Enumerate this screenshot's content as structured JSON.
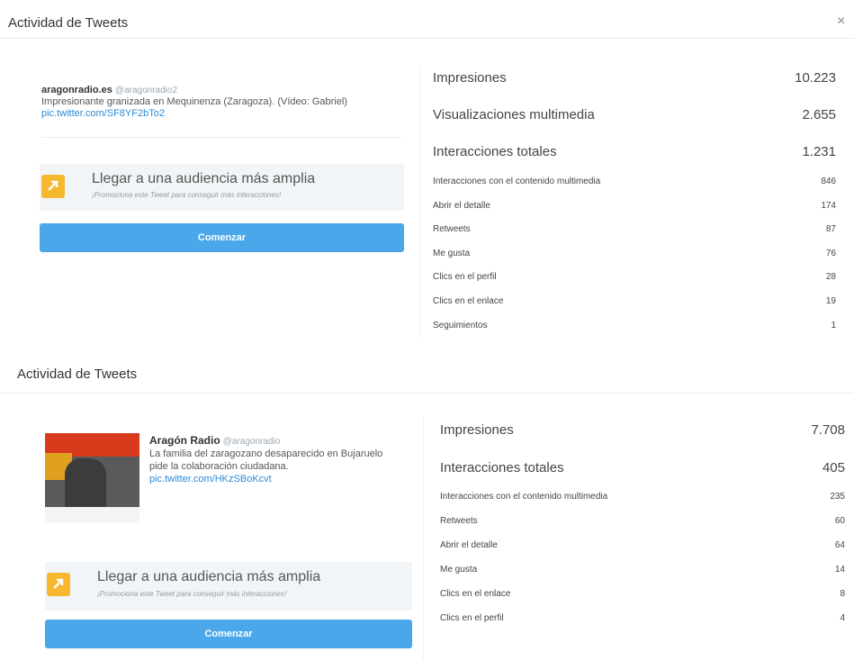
{
  "panel1": {
    "title": "Actividad de Tweets",
    "close": "×",
    "tweet": {
      "name": "aragonradio.es",
      "handle": "@aragonradio2",
      "text": "Impresionante granizada en Mequinenza (Zaragoza). (Vídeo: Gabriel)",
      "link": "pic.twitter.com/SF8YF2bTo2"
    },
    "promo": {
      "title": "Llegar a una audiencia más amplia",
      "subtitle": "¡Promociona este Tweet para conseguir más interacciones!",
      "button": "Comenzar"
    },
    "main_stats": [
      {
        "label": "Impresiones",
        "value": "10.223"
      },
      {
        "label": "Visualizaciones multimedia",
        "value": "2.655"
      },
      {
        "label": "Interacciones totales",
        "value": "1.231"
      }
    ],
    "detail_stats": [
      {
        "label": "Interacciones con el contenido multimedia",
        "value": "846"
      },
      {
        "label": "Abrir el detalle",
        "value": "174"
      },
      {
        "label": "Retweets",
        "value": "87"
      },
      {
        "label": "Me gusta",
        "value": "76"
      },
      {
        "label": "Clics en el perfil",
        "value": "28"
      },
      {
        "label": "Clics en el enlace",
        "value": "19"
      },
      {
        "label": "Seguimientos",
        "value": "1"
      }
    ]
  },
  "panel2": {
    "title": "Actividad de Tweets",
    "tweet": {
      "name": "Aragón Radio",
      "handle": "@aragonradio",
      "text": "La familia del zaragozano desaparecido en Bujaruelo pide la colaboración ciudadana.",
      "link": "pic.twitter.com/HKzSBoKcvt"
    },
    "promo": {
      "title": "Llegar a una audiencia más amplia",
      "subtitle": "¡Promociona este Tweet para conseguir más interacciones!",
      "button": "Comenzar"
    },
    "main_stats": [
      {
        "label": "Impresiones",
        "value": "7.708"
      },
      {
        "label": "Interacciones totales",
        "value": "405"
      }
    ],
    "detail_stats": [
      {
        "label": "Interacciones con el contenido multimedia",
        "value": "235"
      },
      {
        "label": "Retweets",
        "value": "60"
      },
      {
        "label": "Abrir el detalle",
        "value": "64"
      },
      {
        "label": "Me gusta",
        "value": "14"
      },
      {
        "label": "Clics en el enlace",
        "value": "8"
      },
      {
        "label": "Clics en el perfil",
        "value": "4"
      }
    ]
  },
  "colors": {
    "accent": "#4aa8ea",
    "link": "#2b8bd8",
    "promo_icon": "#f5b82e"
  },
  "icons": {
    "promo": "arrow-up-right-icon",
    "close": "close-icon"
  }
}
